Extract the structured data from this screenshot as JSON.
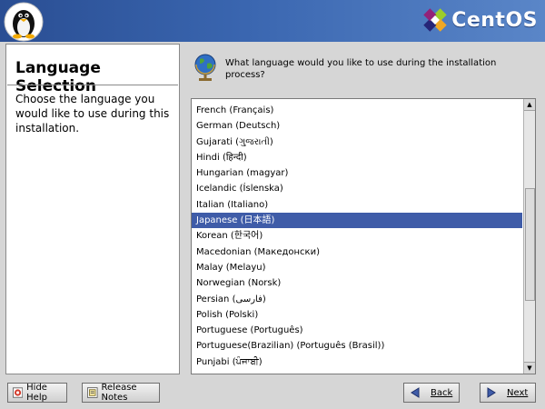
{
  "header": {
    "brand": "CentOS"
  },
  "left_panel": {
    "title": "Language Selection",
    "description": "Choose the language you would like to use during this installation."
  },
  "main": {
    "question": "What language would you like to use during the installation process?",
    "languages": [
      "French (Français)",
      "German (Deutsch)",
      "Gujarati (ગુજરાતી)",
      "Hindi (हिन्दी)",
      "Hungarian (magyar)",
      "Icelandic (Íslenska)",
      "Italian (Italiano)",
      "Japanese (日本語)",
      "Korean (한국어)",
      "Macedonian (Македонски)",
      "Malay (Melayu)",
      "Norwegian (Norsk)",
      "Persian (فارسی)",
      "Polish (Polski)",
      "Portuguese (Português)",
      "Portuguese(Brazilian) (Português (Brasil))",
      "Punjabi (ਪੰਜਾਬੀ)"
    ],
    "selected_language": "Japanese (日本語)"
  },
  "buttons": {
    "hide_help": "Hide Help",
    "release_notes": "Release Notes",
    "back": "Back",
    "next": "Next"
  },
  "colors": {
    "header": "#3a66b0",
    "selection": "#3f5ca8"
  }
}
